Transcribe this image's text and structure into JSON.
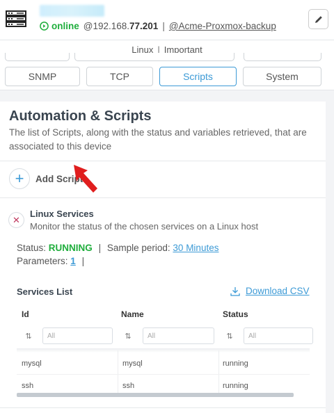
{
  "header": {
    "status": "online",
    "ip_prefix": "@192.168.",
    "ip_suffix": "77.201",
    "separator": "|",
    "hostname": "@Acme-Proxmox-backup"
  },
  "tags": [
    "Linux",
    "Important"
  ],
  "tags_separator": "|",
  "tabs": [
    {
      "label": "SNMP",
      "active": false
    },
    {
      "label": "TCP",
      "active": false
    },
    {
      "label": "Scripts",
      "active": true
    },
    {
      "label": "System",
      "active": false
    }
  ],
  "section": {
    "title": "Automation & Scripts",
    "description": "The list of Scripts, along with the status and variables retrieved, that are associated to this device"
  },
  "add_script": {
    "icon": "plus-icon",
    "label": "Add Script"
  },
  "script": {
    "remove_icon": "close-icon",
    "title": "Linux Services",
    "description": "Monitor the status of the chosen services on a Linux host",
    "status_label": "Status:",
    "status_value": "RUNNING",
    "separator": "|",
    "sample_label": "Sample period:",
    "sample_value": "30 Minutes",
    "params_label": "Parameters:",
    "params_value": "1",
    "params_separator": "|"
  },
  "services": {
    "title": "Services List",
    "download_label": "Download CSV",
    "columns": [
      "Id",
      "Name",
      "Status"
    ],
    "filter_placeholder": "All",
    "sort_icon": "sort-icon",
    "rows": [
      [
        "mysql",
        "mysql",
        "running"
      ],
      [
        "ssh",
        "ssh",
        "running"
      ]
    ]
  },
  "colors": {
    "accent": "#3c9ad6",
    "online": "#1fae3c",
    "remove": "#c0395f",
    "arrow": "#e01e1e"
  }
}
